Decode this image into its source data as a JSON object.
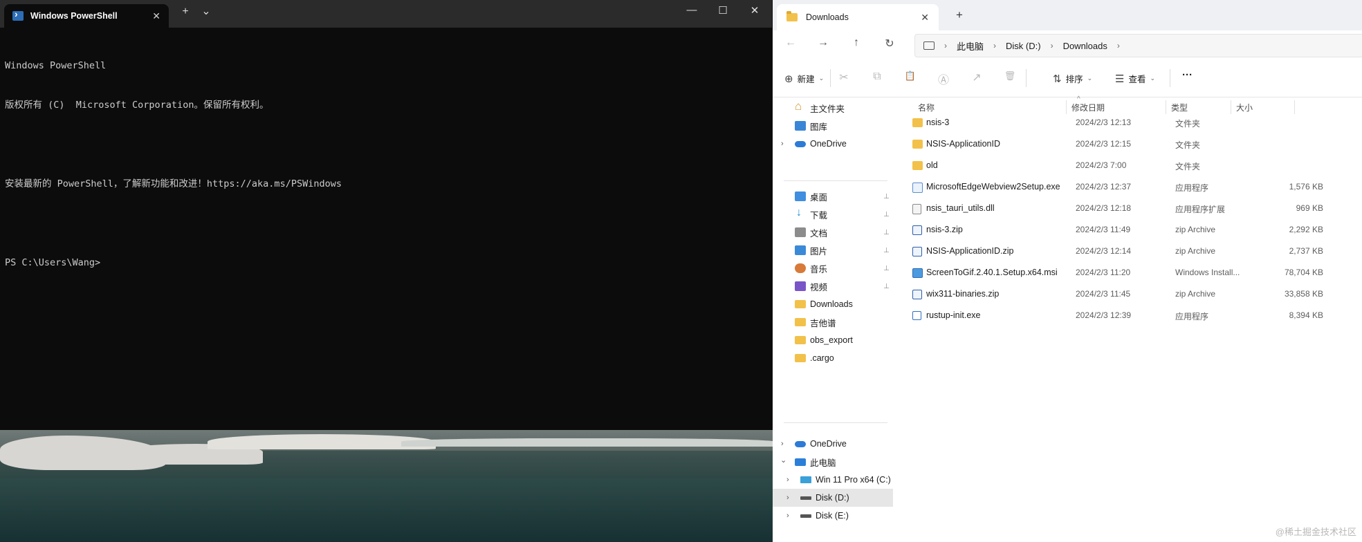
{
  "powershell": {
    "tab_title": "Windows PowerShell",
    "new_tab": "+",
    "dropdown": "⌄",
    "close_tab": "✕",
    "minimize": "—",
    "maximize": "☐",
    "close": "✕",
    "console_lines": [
      "Windows PowerShell",
      "版权所有 (C)  Microsoft Corporation。保留所有权利。",
      "",
      "安装最新的 PowerShell，了解新功能和改进！https://aka.ms/PSWindows",
      "",
      "PS C:\\Users\\Wang>"
    ]
  },
  "explorer": {
    "tab_title": "Downloads",
    "tab_close": "✕",
    "new_tab": "+",
    "nav": {
      "back": "←",
      "forward": "→",
      "up": "↑",
      "refresh": "↻"
    },
    "breadcrumb": [
      "此电脑",
      "Disk (D:)",
      "Downloads"
    ],
    "breadcrumb_sep": "›",
    "commands": {
      "new": "新建",
      "sort": "排序",
      "view": "查看",
      "more": "···",
      "new_icon": "⊕",
      "sort_icon": "⇅",
      "view_icon": "☰",
      "cut_icon": "✂",
      "copy_icon": "⧉",
      "paste_icon": "📋",
      "rename_icon": "Ⓐ",
      "share_icon": "↗",
      "delete_icon": "🗑",
      "caret": "⌄"
    },
    "sidebar": {
      "quick": [
        {
          "label": "主文件夹",
          "icon": "home-icon"
        },
        {
          "label": "图库",
          "icon": "gallery-icon"
        },
        {
          "label": "OneDrive",
          "icon": "onedrive-icon"
        }
      ],
      "pinned": [
        {
          "label": "桌面",
          "icon": "desktop-icon"
        },
        {
          "label": "下载",
          "icon": "download-icon"
        },
        {
          "label": "文档",
          "icon": "document-icon"
        },
        {
          "label": "图片",
          "icon": "pictures-icon"
        },
        {
          "label": "音乐",
          "icon": "music-icon"
        },
        {
          "label": "视频",
          "icon": "video-icon"
        }
      ],
      "folders": [
        "Downloads",
        "吉他谱",
        "obs_export",
        ".cargo"
      ],
      "tree": [
        {
          "label": "OneDrive",
          "icon": "onedrive-icon"
        },
        {
          "label": "此电脑",
          "icon": "pc-icon"
        },
        {
          "label": "Win 11 Pro x64 (C:)",
          "icon": "windows-drive-icon"
        },
        {
          "label": "Disk (D:)",
          "icon": "drive-icon"
        },
        {
          "label": "Disk (E:)",
          "icon": "drive-icon"
        }
      ],
      "pin_glyph": "📌",
      "chevron_right": "›",
      "chevron_down": "⌄"
    },
    "columns": {
      "name": "名称",
      "date": "修改日期",
      "type": "类型",
      "size": "大小",
      "sort_glyph": "^"
    },
    "files": [
      {
        "name": "nsis-3",
        "date": "2024/2/3 12:13",
        "type": "文件夹",
        "size": "",
        "kind": "folder"
      },
      {
        "name": "NSIS-ApplicationID",
        "date": "2024/2/3 12:15",
        "type": "文件夹",
        "size": "",
        "kind": "folder"
      },
      {
        "name": "old",
        "date": "2024/2/3 7:00",
        "type": "文件夹",
        "size": "",
        "kind": "folder"
      },
      {
        "name": "MicrosoftEdgeWebview2Setup.exe",
        "date": "2024/2/3 12:37",
        "type": "应用程序",
        "size": "1,576 KB",
        "kind": "exe"
      },
      {
        "name": "nsis_tauri_utils.dll",
        "date": "2024/2/3 12:18",
        "type": "应用程序扩展",
        "size": "969 KB",
        "kind": "dll"
      },
      {
        "name": "nsis-3.zip",
        "date": "2024/2/3 11:49",
        "type": "zip Archive",
        "size": "2,292 KB",
        "kind": "zip"
      },
      {
        "name": "NSIS-ApplicationID.zip",
        "date": "2024/2/3 12:14",
        "type": "zip Archive",
        "size": "2,737 KB",
        "kind": "zip"
      },
      {
        "name": "ScreenToGif.2.40.1.Setup.x64.msi",
        "date": "2024/2/3 11:20",
        "type": "Windows Install...",
        "size": "78,704 KB",
        "kind": "msi"
      },
      {
        "name": "wix311-binaries.zip",
        "date": "2024/2/3 11:45",
        "type": "zip Archive",
        "size": "33,858 KB",
        "kind": "zip"
      },
      {
        "name": "rustup-init.exe",
        "date": "2024/2/3 12:39",
        "type": "应用程序",
        "size": "8,394 KB",
        "kind": "rust"
      }
    ]
  },
  "watermark": "@稀土掘金技术社区"
}
